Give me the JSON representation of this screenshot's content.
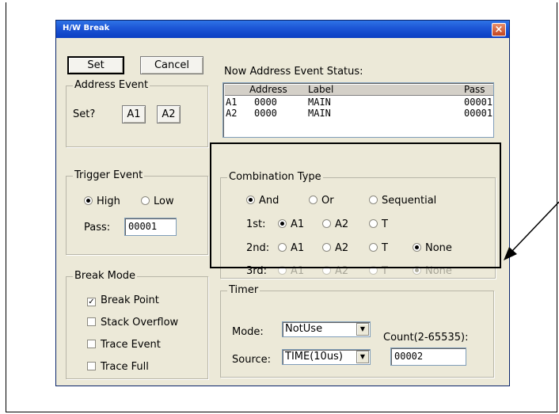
{
  "dialog": {
    "title": "H/W Break",
    "close_glyph": "×"
  },
  "buttons": {
    "set": "Set",
    "cancel": "Cancel"
  },
  "address_event": {
    "legend": "Address Event",
    "set_label": "Set?",
    "a1": "A1",
    "a2": "A2"
  },
  "status": {
    "title": "Now Address Event Status:",
    "headers": [
      "",
      "Address",
      "Label",
      "Pass"
    ],
    "rows": [
      [
        "A1",
        "0000",
        "MAIN",
        "00001"
      ],
      [
        "A2",
        "0000",
        "MAIN",
        "00001"
      ]
    ]
  },
  "trigger_event": {
    "legend": "Trigger Event",
    "high": "High",
    "low": "Low",
    "selected": "High",
    "pass_label": "Pass:",
    "pass_value": "00001"
  },
  "combination": {
    "legend": "Combination Type",
    "types": [
      "And",
      "Or",
      "Sequential"
    ],
    "selected_type": "And",
    "rows": [
      {
        "label": "1st:",
        "options": [
          "A1",
          "A2",
          "T"
        ],
        "selected": "A1",
        "disabled": false
      },
      {
        "label": "2nd:",
        "options": [
          "A1",
          "A2",
          "T",
          "None"
        ],
        "selected": "None",
        "disabled": false
      },
      {
        "label": "3rd:",
        "options": [
          "A1",
          "A2",
          "T",
          "None"
        ],
        "selected": "None",
        "disabled": true
      }
    ]
  },
  "break_mode": {
    "legend": "Break Mode",
    "items": [
      {
        "label": "Break Point",
        "checked": true
      },
      {
        "label": "Stack Overflow",
        "checked": false
      },
      {
        "label": "Trace Event",
        "checked": false
      },
      {
        "label": "Trace Full",
        "checked": false
      }
    ]
  },
  "timer": {
    "legend": "Timer",
    "mode_label": "Mode:",
    "mode_value": "NotUse",
    "source_label": "Source:",
    "source_value": "TIME(10us)",
    "count_label": "Count(2-65535):",
    "count_value": "00002"
  },
  "glyphs": {
    "checkmark": "✓",
    "dropdown": "▼"
  }
}
